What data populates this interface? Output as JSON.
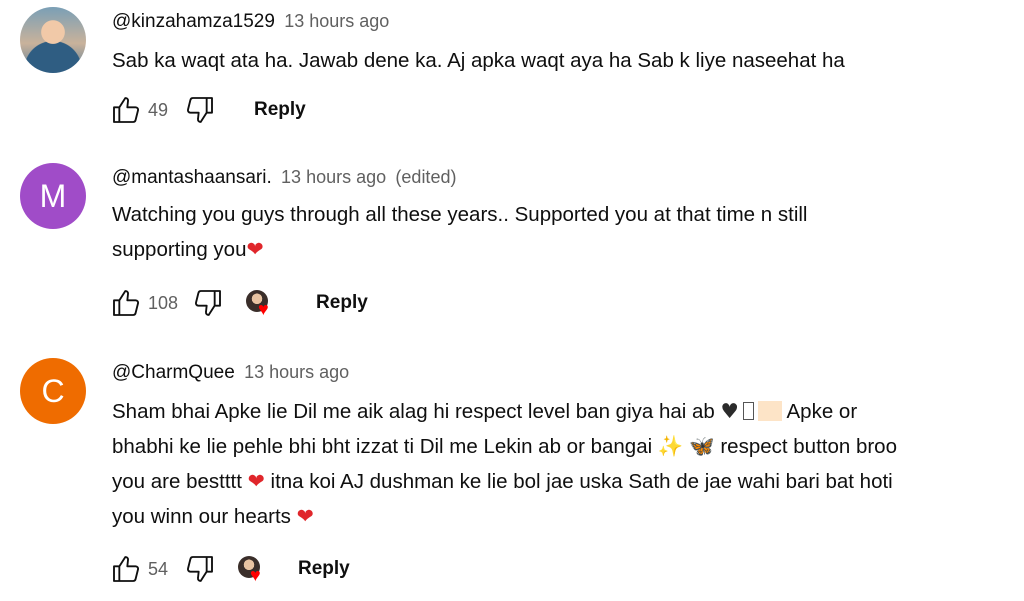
{
  "comments": [
    {
      "handle": "@kinzahamza1529",
      "time": "13 hours ago",
      "edited": "",
      "avatar_letter": "",
      "lines": [
        "Sab ka waqt ata ha. Jawab dene ka. Aj apka waqt aya ha Sab k liye naseehat ha"
      ],
      "likes": "49",
      "reply_label": "Reply",
      "creator_heart": false
    },
    {
      "handle": "@mantashaansari.",
      "time": "13 hours ago",
      "edited": "(edited)",
      "avatar_letter": "M",
      "avatar_color": "#a04cc8",
      "lines": [
        "Watching you guys through all these years.. Supported you at that time n still",
        "supporting you"
      ],
      "likes": "108",
      "reply_label": "Reply",
      "creator_heart": true
    },
    {
      "handle": "@CharmQuee",
      "time": "13 hours ago",
      "edited": "",
      "avatar_letter": "C",
      "avatar_color": "#ef6c00",
      "lines": [
        "Sham bhai Apke lie Dil me aik alag hi respect level ban giya hai ab",
        "Apke or",
        "bhabhi ke lie pehle bhi bht izzat ti Dil me Lekin ab or bangai",
        "respect button broo",
        "you are bestttt",
        "itna koi AJ dushman ke lie bol jae uska Sath de jae wahi bari bat hoti",
        "you winn our hearts"
      ],
      "likes": "54",
      "reply_label": "Reply",
      "creator_heart": true
    }
  ],
  "icons": {
    "like": "thumbs-up-icon",
    "dislike": "thumbs-down-icon",
    "heart": "heart-icon",
    "black_heart": "black-heart-icon",
    "sparkles": "sparkles-icon",
    "butterfly": "butterfly-icon"
  },
  "colors": {
    "heart_red": "#e0262b",
    "creator_heart_red": "#ff0000",
    "meta_gray": "#606060"
  }
}
